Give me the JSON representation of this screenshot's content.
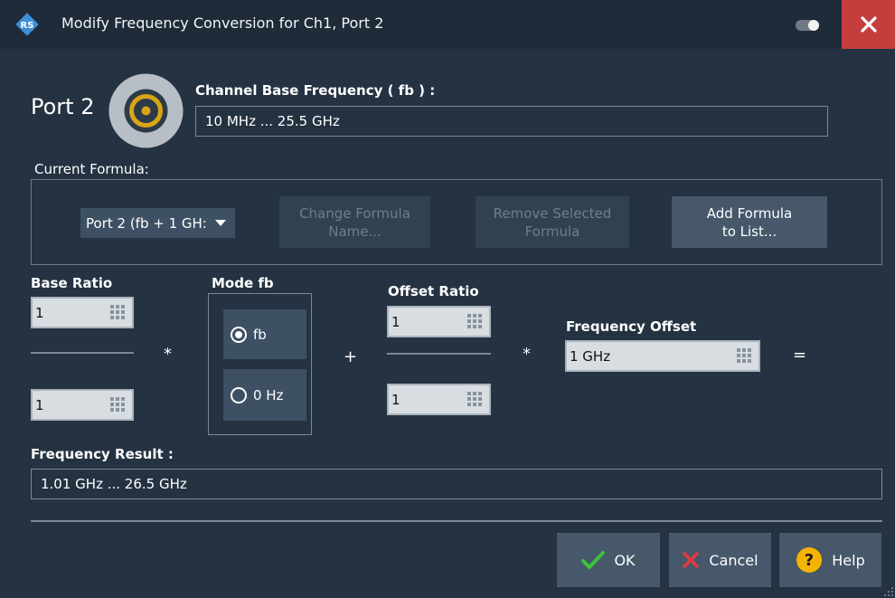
{
  "window": {
    "title": "Modify Frequency Conversion for Ch1, Port 2"
  },
  "port": {
    "label": "Port 2"
  },
  "base_frequency": {
    "label": "Channel Base Frequency ( fb ) :",
    "value": "10 MHz ... 25.5 GHz"
  },
  "formula": {
    "label": "Current Formula:",
    "selected": "Port 2 (fb + 1 GH:",
    "change_btn": [
      "Change Formula",
      "Name..."
    ],
    "remove_btn": [
      "Remove Selected",
      "Formula"
    ],
    "add_btn": [
      "Add Formula",
      "to List..."
    ]
  },
  "base_ratio": {
    "label": "Base Ratio",
    "numerator": "1",
    "denominator": "1"
  },
  "mode": {
    "label": "Mode  fb",
    "options": [
      {
        "label": "fb",
        "selected": true
      },
      {
        "label": "0 Hz",
        "selected": false
      }
    ]
  },
  "offset_ratio": {
    "label": "Offset Ratio",
    "numerator": "1",
    "denominator": "1"
  },
  "frequency_offset": {
    "label": "Frequency Offset",
    "value": "1 GHz"
  },
  "operators": {
    "multiply": "*",
    "plus": "+",
    "equals": "="
  },
  "result": {
    "label": "Frequency Result :",
    "value": "1.01 GHz ... 26.5 GHz"
  },
  "actions": {
    "ok": "OK",
    "cancel": "Cancel",
    "help": "Help"
  },
  "colors": {
    "close_red": "#c43e3e",
    "ok_green": "#3cc23c",
    "cancel_red": "#e03a3a",
    "help_yellow": "#f5b400",
    "port_ring": "#d9a514"
  },
  "icons": [
    "rs-logo-icon",
    "toggle-icon",
    "close-icon",
    "port-connector-icon",
    "keypad-icon",
    "checkmark-icon",
    "x-icon",
    "help-icon",
    "resize-grip-icon"
  ]
}
